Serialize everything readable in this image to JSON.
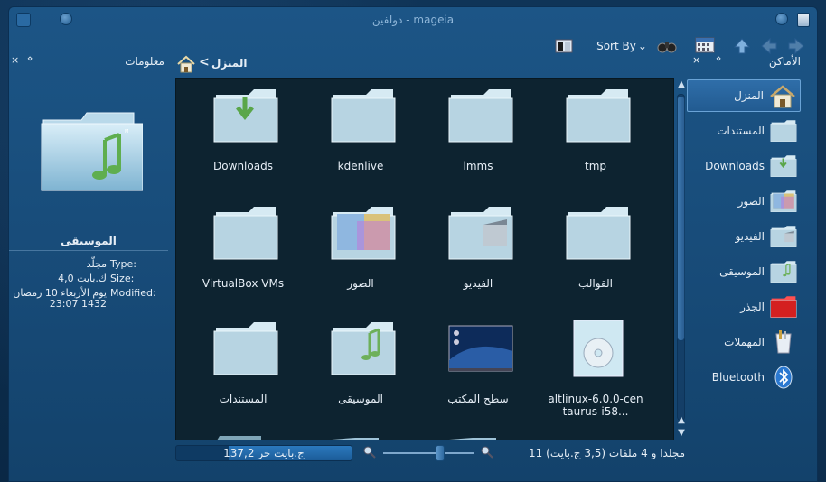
{
  "window": {
    "title": "دولفين - mageia"
  },
  "toolbar": {
    "sort_label": "Sort By",
    "sort_arrow": "⌄"
  },
  "info_panel": {
    "title": "معلومات",
    "close": "×",
    "detach": "⋄",
    "name": "الموسيقى",
    "rows": [
      {
        "label": "Type:",
        "value": "مجلّد"
      },
      {
        "label": "Size:",
        "value": "4,0 ك.بايت"
      },
      {
        "label": "Modified:",
        "value": "يوم الأربعاء 10 رمضان 1432 23:07"
      }
    ]
  },
  "breadcrumb": {
    "separator": "<",
    "current": "المنزل"
  },
  "files": [
    {
      "name": "Downloads",
      "icon": "folder-downloads-icon",
      "kind": "downloads"
    },
    {
      "name": "kdenlive",
      "icon": "folder-icon",
      "kind": "folder"
    },
    {
      "name": "lmms",
      "icon": "folder-icon",
      "kind": "folder"
    },
    {
      "name": "tmp",
      "icon": "folder-icon",
      "kind": "folder"
    },
    {
      "name": "VirtualBox VMs",
      "icon": "folder-icon",
      "kind": "folder"
    },
    {
      "name": "الصور",
      "icon": "folder-images-icon",
      "kind": "images"
    },
    {
      "name": "الفيديو",
      "icon": "folder-video-icon",
      "kind": "video"
    },
    {
      "name": "القوالب",
      "icon": "folder-icon",
      "kind": "folder"
    },
    {
      "name": "المستندات",
      "icon": "folder-icon",
      "kind": "folder"
    },
    {
      "name": "الموسيقى",
      "icon": "folder-music-icon",
      "kind": "music"
    },
    {
      "name": "سطح المكتب",
      "icon": "desktop-icon",
      "kind": "desktop"
    },
    {
      "name": "altlinux-6.0.0-centaurus-i58...",
      "icon": "disc-image-icon",
      "kind": "iso"
    }
  ],
  "status": {
    "summary": "11 مجلدا و 4 ملفات (3,5 ج.بايت)",
    "free_space": "137,2 ج.بايت حر",
    "used_fraction": 0.7
  },
  "places": {
    "title": "الأماكن",
    "close": "×",
    "detach": "⋄",
    "items": [
      {
        "label": "المنزل",
        "icon": "home-icon",
        "selected": true
      },
      {
        "label": "المستندات",
        "icon": "folder-icon"
      },
      {
        "label": "Downloads",
        "icon": "folder-downloads-icon"
      },
      {
        "label": "الصور",
        "icon": "folder-images-icon"
      },
      {
        "label": "الفيديو",
        "icon": "folder-video-icon"
      },
      {
        "label": "الموسيقى",
        "icon": "folder-music-icon"
      },
      {
        "label": "الجذر",
        "icon": "root-folder-icon"
      },
      {
        "label": "المهملات",
        "icon": "trash-icon"
      },
      {
        "label": "Bluetooth",
        "icon": "bluetooth-icon"
      }
    ]
  },
  "colors": {
    "accent": "#2f6ea9",
    "view_bg": "#0d2330",
    "root_red": "#d42020"
  }
}
